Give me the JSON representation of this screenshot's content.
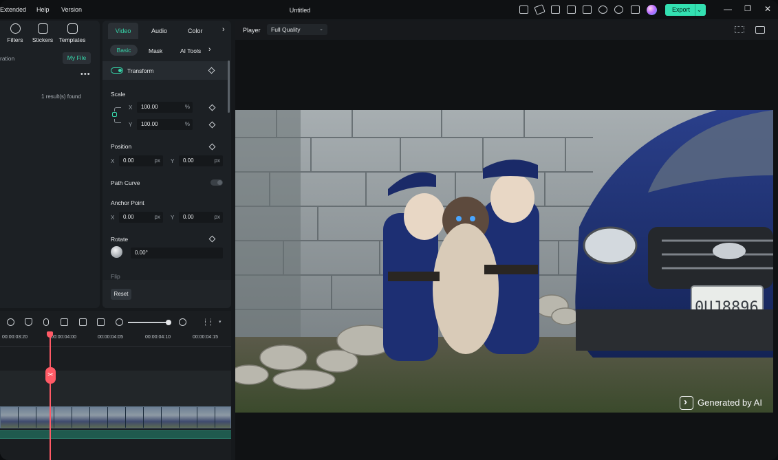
{
  "menu": {
    "items": [
      "Extended",
      "Help",
      "Version"
    ]
  },
  "window": {
    "title": "Untitled"
  },
  "export": {
    "label": "Export",
    "caret": "⌄"
  },
  "win_controls": {
    "minimize": "—",
    "maximize": "❐",
    "close": "✕"
  },
  "media": {
    "tabs": [
      {
        "label": "Filters"
      },
      {
        "label": "Stickers"
      },
      {
        "label": "Templates"
      }
    ],
    "gen_label": "ration",
    "myfile_label": "My File",
    "more": "•••",
    "results": "1 result(s) found"
  },
  "props": {
    "tabs": [
      "Video",
      "Audio",
      "Color"
    ],
    "tab_more": "›",
    "subtabs": [
      "Basic",
      "Mask",
      "AI Tools"
    ],
    "subtab_more": "›",
    "transform": "Transform",
    "scale": {
      "label": "Scale",
      "x_axis": "X",
      "x_value": "100.00",
      "x_unit": "%",
      "y_axis": "Y",
      "y_value": "100.00",
      "y_unit": "%"
    },
    "position": {
      "label": "Position",
      "x_axis": "X",
      "x_value": "0.00",
      "x_unit": "px",
      "y_axis": "Y",
      "y_value": "0.00",
      "y_unit": "px"
    },
    "path_curve": "Path Curve",
    "anchor": {
      "label": "Anchor Point",
      "x_axis": "X",
      "x_value": "0.00",
      "x_unit": "px",
      "y_axis": "Y",
      "y_value": "0.00",
      "y_unit": "px"
    },
    "rotate": {
      "label": "Rotate",
      "value": "0.00°"
    },
    "flip": "Flip",
    "reset": "Reset"
  },
  "timeline": {
    "ticks": [
      "00:00:03:20",
      "00:00:04:00",
      "00:00:04:05",
      "00:00:04:10",
      "00:00:04:15"
    ],
    "caret": "▾"
  },
  "player": {
    "label": "Player",
    "quality": "Full Quality",
    "quality_caret": "⌄"
  },
  "watermark": {
    "text": "Generated by AI"
  },
  "colors": {
    "accent": "#33e0b1",
    "playhead": "#ff5a66"
  }
}
